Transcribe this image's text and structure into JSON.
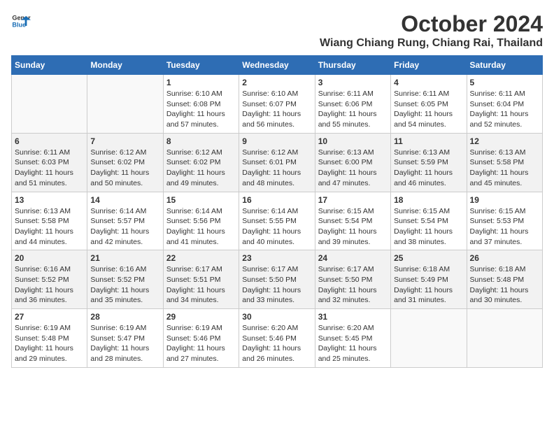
{
  "header": {
    "logo_line1": "General",
    "logo_line2": "Blue",
    "month_title": "October 2024",
    "location": "Wiang Chiang Rung, Chiang Rai, Thailand"
  },
  "weekdays": [
    "Sunday",
    "Monday",
    "Tuesday",
    "Wednesday",
    "Thursday",
    "Friday",
    "Saturday"
  ],
  "weeks": [
    [
      {
        "day": "",
        "empty": true
      },
      {
        "day": "",
        "empty": true
      },
      {
        "day": "1",
        "sunrise": "Sunrise: 6:10 AM",
        "sunset": "Sunset: 6:08 PM",
        "daylight": "Daylight: 11 hours and 57 minutes."
      },
      {
        "day": "2",
        "sunrise": "Sunrise: 6:10 AM",
        "sunset": "Sunset: 6:07 PM",
        "daylight": "Daylight: 11 hours and 56 minutes."
      },
      {
        "day": "3",
        "sunrise": "Sunrise: 6:11 AM",
        "sunset": "Sunset: 6:06 PM",
        "daylight": "Daylight: 11 hours and 55 minutes."
      },
      {
        "day": "4",
        "sunrise": "Sunrise: 6:11 AM",
        "sunset": "Sunset: 6:05 PM",
        "daylight": "Daylight: 11 hours and 54 minutes."
      },
      {
        "day": "5",
        "sunrise": "Sunrise: 6:11 AM",
        "sunset": "Sunset: 6:04 PM",
        "daylight": "Daylight: 11 hours and 52 minutes."
      }
    ],
    [
      {
        "day": "6",
        "sunrise": "Sunrise: 6:11 AM",
        "sunset": "Sunset: 6:03 PM",
        "daylight": "Daylight: 11 hours and 51 minutes."
      },
      {
        "day": "7",
        "sunrise": "Sunrise: 6:12 AM",
        "sunset": "Sunset: 6:02 PM",
        "daylight": "Daylight: 11 hours and 50 minutes."
      },
      {
        "day": "8",
        "sunrise": "Sunrise: 6:12 AM",
        "sunset": "Sunset: 6:02 PM",
        "daylight": "Daylight: 11 hours and 49 minutes."
      },
      {
        "day": "9",
        "sunrise": "Sunrise: 6:12 AM",
        "sunset": "Sunset: 6:01 PM",
        "daylight": "Daylight: 11 hours and 48 minutes."
      },
      {
        "day": "10",
        "sunrise": "Sunrise: 6:13 AM",
        "sunset": "Sunset: 6:00 PM",
        "daylight": "Daylight: 11 hours and 47 minutes."
      },
      {
        "day": "11",
        "sunrise": "Sunrise: 6:13 AM",
        "sunset": "Sunset: 5:59 PM",
        "daylight": "Daylight: 11 hours and 46 minutes."
      },
      {
        "day": "12",
        "sunrise": "Sunrise: 6:13 AM",
        "sunset": "Sunset: 5:58 PM",
        "daylight": "Daylight: 11 hours and 45 minutes."
      }
    ],
    [
      {
        "day": "13",
        "sunrise": "Sunrise: 6:13 AM",
        "sunset": "Sunset: 5:58 PM",
        "daylight": "Daylight: 11 hours and 44 minutes."
      },
      {
        "day": "14",
        "sunrise": "Sunrise: 6:14 AM",
        "sunset": "Sunset: 5:57 PM",
        "daylight": "Daylight: 11 hours and 42 minutes."
      },
      {
        "day": "15",
        "sunrise": "Sunrise: 6:14 AM",
        "sunset": "Sunset: 5:56 PM",
        "daylight": "Daylight: 11 hours and 41 minutes."
      },
      {
        "day": "16",
        "sunrise": "Sunrise: 6:14 AM",
        "sunset": "Sunset: 5:55 PM",
        "daylight": "Daylight: 11 hours and 40 minutes."
      },
      {
        "day": "17",
        "sunrise": "Sunrise: 6:15 AM",
        "sunset": "Sunset: 5:54 PM",
        "daylight": "Daylight: 11 hours and 39 minutes."
      },
      {
        "day": "18",
        "sunrise": "Sunrise: 6:15 AM",
        "sunset": "Sunset: 5:54 PM",
        "daylight": "Daylight: 11 hours and 38 minutes."
      },
      {
        "day": "19",
        "sunrise": "Sunrise: 6:15 AM",
        "sunset": "Sunset: 5:53 PM",
        "daylight": "Daylight: 11 hours and 37 minutes."
      }
    ],
    [
      {
        "day": "20",
        "sunrise": "Sunrise: 6:16 AM",
        "sunset": "Sunset: 5:52 PM",
        "daylight": "Daylight: 11 hours and 36 minutes."
      },
      {
        "day": "21",
        "sunrise": "Sunrise: 6:16 AM",
        "sunset": "Sunset: 5:52 PM",
        "daylight": "Daylight: 11 hours and 35 minutes."
      },
      {
        "day": "22",
        "sunrise": "Sunrise: 6:17 AM",
        "sunset": "Sunset: 5:51 PM",
        "daylight": "Daylight: 11 hours and 34 minutes."
      },
      {
        "day": "23",
        "sunrise": "Sunrise: 6:17 AM",
        "sunset": "Sunset: 5:50 PM",
        "daylight": "Daylight: 11 hours and 33 minutes."
      },
      {
        "day": "24",
        "sunrise": "Sunrise: 6:17 AM",
        "sunset": "Sunset: 5:50 PM",
        "daylight": "Daylight: 11 hours and 32 minutes."
      },
      {
        "day": "25",
        "sunrise": "Sunrise: 6:18 AM",
        "sunset": "Sunset: 5:49 PM",
        "daylight": "Daylight: 11 hours and 31 minutes."
      },
      {
        "day": "26",
        "sunrise": "Sunrise: 6:18 AM",
        "sunset": "Sunset: 5:48 PM",
        "daylight": "Daylight: 11 hours and 30 minutes."
      }
    ],
    [
      {
        "day": "27",
        "sunrise": "Sunrise: 6:19 AM",
        "sunset": "Sunset: 5:48 PM",
        "daylight": "Daylight: 11 hours and 29 minutes."
      },
      {
        "day": "28",
        "sunrise": "Sunrise: 6:19 AM",
        "sunset": "Sunset: 5:47 PM",
        "daylight": "Daylight: 11 hours and 28 minutes."
      },
      {
        "day": "29",
        "sunrise": "Sunrise: 6:19 AM",
        "sunset": "Sunset: 5:46 PM",
        "daylight": "Daylight: 11 hours and 27 minutes."
      },
      {
        "day": "30",
        "sunrise": "Sunrise: 6:20 AM",
        "sunset": "Sunset: 5:46 PM",
        "daylight": "Daylight: 11 hours and 26 minutes."
      },
      {
        "day": "31",
        "sunrise": "Sunrise: 6:20 AM",
        "sunset": "Sunset: 5:45 PM",
        "daylight": "Daylight: 11 hours and 25 minutes."
      },
      {
        "day": "",
        "empty": true
      },
      {
        "day": "",
        "empty": true
      }
    ]
  ]
}
